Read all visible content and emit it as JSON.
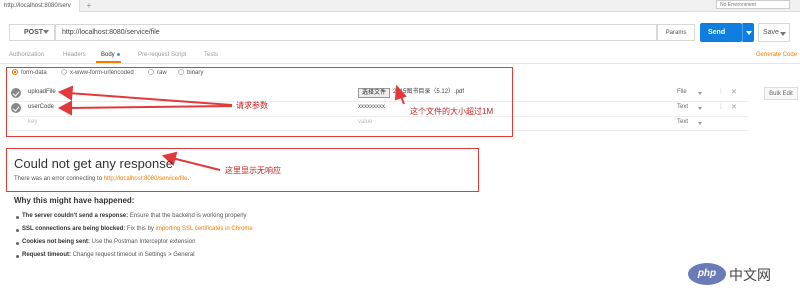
{
  "top": {
    "tab_title": "http://localhost:8080/serv",
    "plus": "+",
    "environment": "No Environment"
  },
  "request": {
    "method": "POST",
    "url": "http://localhost:8080/service/file",
    "params_label": "Params",
    "send_label": "Send",
    "save_label": "Save"
  },
  "tabs": {
    "authorization": "Authorization",
    "headers": "Headers",
    "body": "Body",
    "prerequest": "Pre-request Script",
    "tests": "Tests",
    "generate_code": "Generate Code"
  },
  "body_types": {
    "form_data": "form-data",
    "urlencoded": "x-www-form-urlencoded",
    "raw": "raw",
    "binary": "binary"
  },
  "rows": [
    {
      "key": "uploadFile",
      "file_button": "选择文件",
      "value": "2015图书目录（5.12）.pdf",
      "type": "File"
    },
    {
      "key": "userCode",
      "value": "xxxxxxxxx",
      "type": "Text"
    },
    {
      "key_placeholder": "key",
      "value_placeholder": "value",
      "type": "Text"
    }
  ],
  "row_menu": "⋮",
  "row_close": "✕",
  "bulk_edit": "Bulk Edit",
  "annotations": {
    "params": "请求参数",
    "filesize": "这个文件的大小超过1M",
    "noresponse": "这里显示无响应"
  },
  "response": {
    "title": "Could not get any response",
    "sub_prefix": "There was an error connecting to ",
    "sub_link": "http://localhost:8080/service/file",
    "sub_suffix": ".",
    "why_title": "Why this might have happened:",
    "reasons": [
      {
        "bold": "The server couldn't send a response:",
        "text": " Ensure that the backend is working properly",
        "link": ""
      },
      {
        "bold": "SSL connections are being blocked:",
        "text": " Fix this by ",
        "link": "importing SSL certificates in Chrome"
      },
      {
        "bold": "Cookies not being sent:",
        "text": " Use the Postman Interceptor extension",
        "link": ""
      },
      {
        "bold": "Request timeout:",
        "text": " Change request timeout in Settings > General",
        "link": ""
      }
    ]
  },
  "watermark": {
    "logo": "php",
    "text": "中文网"
  },
  "colors": {
    "accent": "#f57c00",
    "send": "#0e7fe0",
    "annotation": "#e23a3a"
  }
}
